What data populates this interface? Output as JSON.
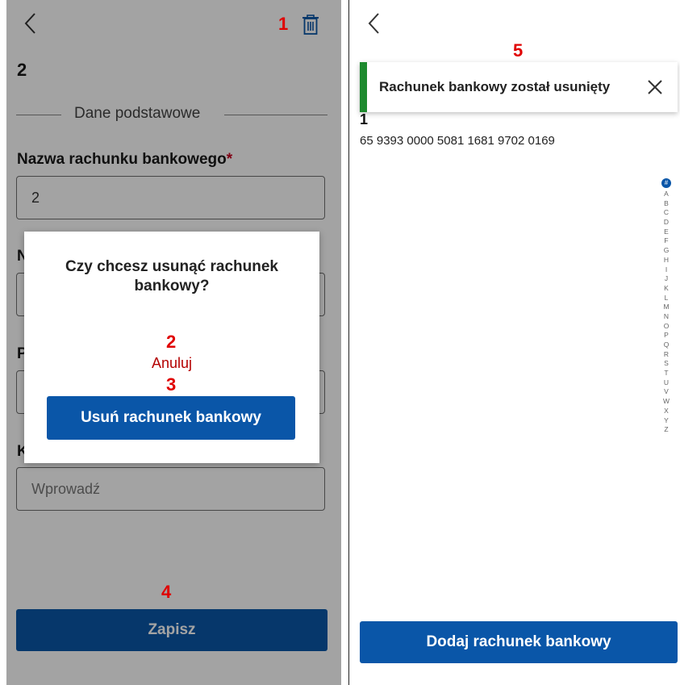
{
  "left_screen": {
    "page_title": "2",
    "section_title": "Dane podstawowe",
    "field_label": "Nazwa rachunku bankowego",
    "required_mark": "*",
    "name_value": "2",
    "hidden_label_initials": [
      "N",
      "P",
      "K"
    ],
    "last_field_placeholder": "Wprowadź",
    "save_label": "Zapisz",
    "dialog": {
      "question": "Czy chcesz usunąć rachunek bankowy?",
      "cancel_label": "Anuluj",
      "confirm_label": "Usuń rachunek bankowy"
    }
  },
  "annotations": {
    "a1": "1",
    "a2": "2",
    "a3": "3",
    "a4": "4",
    "a5": "5"
  },
  "right_screen": {
    "toast_message": "Rachunek bankowy został usunięty",
    "account": {
      "name": "1",
      "number": "65 9393 0000 5081 1681 9702 0169"
    },
    "alphabet_index": {
      "hash": "#",
      "letters": [
        "A",
        "B",
        "C",
        "D",
        "E",
        "F",
        "G",
        "H",
        "I",
        "J",
        "K",
        "L",
        "M",
        "N",
        "O",
        "P",
        "Q",
        "R",
        "S",
        "T",
        "U",
        "V",
        "W",
        "X",
        "Y",
        "Z"
      ]
    },
    "add_label": "Dodaj rachunek bankowy"
  },
  "colors": {
    "primary": "#0a56a8",
    "annotation": "#e00000",
    "cancel_text": "#b40000",
    "required": "#c8001e",
    "toast_accent": "#1e8a2e"
  },
  "icons": [
    "back-icon",
    "trash-icon",
    "close-icon"
  ]
}
